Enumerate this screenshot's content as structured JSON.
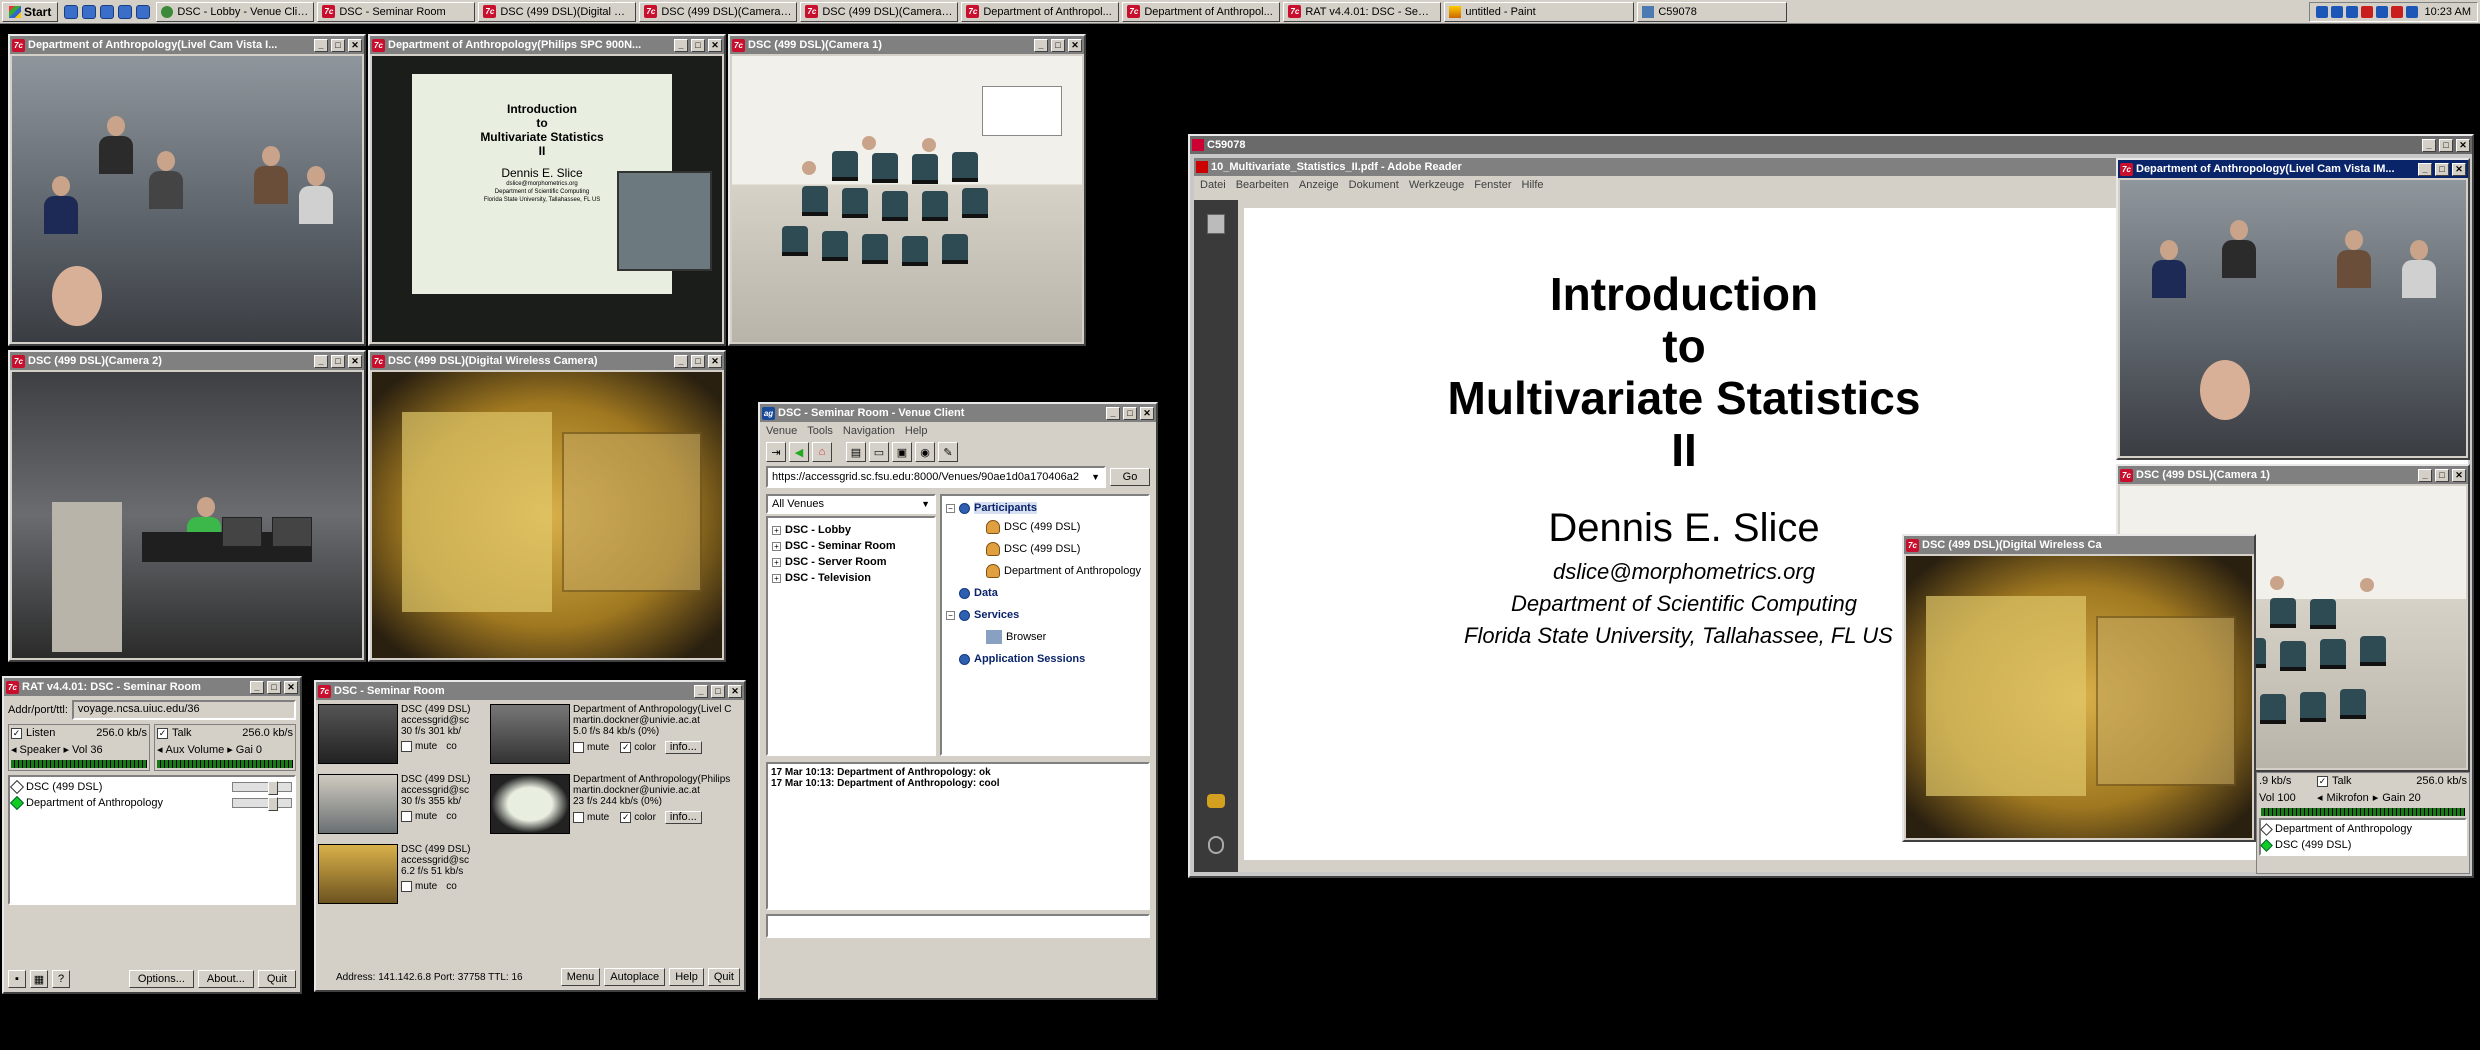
{
  "taskbar": {
    "start_label": "Start",
    "tasks": [
      {
        "label": "DSC - Lobby - Venue Clie...",
        "icon": "globe-icon"
      },
      {
        "label": "DSC - Seminar Room",
        "icon": "vic-icon"
      },
      {
        "label": "DSC (499 DSL)(Digital Wi...",
        "icon": "vic-icon"
      },
      {
        "label": "DSC (499 DSL)(Camera 2)",
        "icon": "vic-icon"
      },
      {
        "label": "DSC (499 DSL)(Camera 1)",
        "icon": "vic-icon"
      },
      {
        "label": "Department of Anthropol...",
        "icon": "vic-icon"
      },
      {
        "label": "Department of Anthropol...",
        "icon": "vic-icon"
      },
      {
        "label": "RAT v4.4.01: DSC - Semi...",
        "icon": "vic-icon"
      },
      {
        "label": "untitled - Paint",
        "icon": "paint-icon"
      },
      {
        "label": "C59078",
        "icon": "vnc-icon"
      }
    ],
    "clock": "10:23 AM"
  },
  "video_windows": {
    "anthro_cam": {
      "title": "Department of Anthropology(Livel Cam Vista I..."
    },
    "anthro_philips": {
      "title": "Department of Anthropology(Philips SPC 900N..."
    },
    "cam1": {
      "title": "DSC (499 DSL)(Camera 1)"
    },
    "cam2": {
      "title": "DSC (499 DSL)(Camera 2)"
    },
    "wireless": {
      "title": "DSC (499 DSL)(Digital Wireless Camera)"
    }
  },
  "slide": {
    "line1": "Introduction",
    "line2": "to",
    "line3": "Multivariate Statistics",
    "line4": "II",
    "author": "Dennis E. Slice",
    "email": "dslice@morphometrics.org",
    "dept": "Department of Scientific Computing",
    "univ": "Florida State University, Tallahassee, FL US"
  },
  "venue_client": {
    "title": "DSC - Seminar Room - Venue Client",
    "menu": [
      "Venue",
      "Tools",
      "Navigation",
      "Help"
    ],
    "url": "https://accessgrid.sc.fsu.edu:8000/Venues/90ae1d0a170406a2",
    "go_label": "Go",
    "venues_select": "All Venues",
    "venues": [
      "DSC - Lobby",
      "DSC - Seminar Room",
      "DSC - Server Room",
      "DSC - Television"
    ],
    "participants_label": "Participants",
    "participants": [
      "DSC (499 DSL)",
      "DSC (499 DSL)",
      "Department of Anthropology"
    ],
    "data_label": "Data",
    "services_label": "Services",
    "browser_label": "Browser",
    "app_sessions_label": "Application Sessions",
    "chat": [
      "17 Mar 10:13: Department of Anthropology: ok",
      "17 Mar 10:13: Department of Anthropology: cool"
    ]
  },
  "rat": {
    "title": "RAT v4.4.01: DSC - Seminar Room",
    "addr_label": "Addr/port/ttl:",
    "addr_value": "voyage.ncsa.uiuc.edu/36",
    "listen_label": "Listen",
    "listen_rate": "256.0 kb/s",
    "talk_label": "Talk",
    "talk_rate": "256.0 kb/s",
    "speaker_label": "Speaker",
    "vol_label": "Vol",
    "vol_value": "36",
    "aux_label": "Aux Volume",
    "gain_label": "Gai",
    "gain_value": "0",
    "participants": [
      "DSC (499 DSL)",
      "Department of Anthropology"
    ],
    "options_label": "Options...",
    "about_label": "About...",
    "quit_label": "Quit"
  },
  "vic": {
    "title": "DSC - Seminar Room",
    "streams": [
      {
        "name": "DSC (499 DSL)",
        "email": "accessgrid@sc",
        "stats": "30 f/s  301 kb/",
        "mute": "mute",
        "color": "co"
      },
      {
        "name": "Department of Anthropology(Livel C",
        "email": "martin.dockner@univie.ac.at",
        "stats": "5.0 f/s    84 kb/s    (0%)",
        "mute": "mute",
        "color": "color",
        "info": "info..."
      },
      {
        "name": "DSC (499 DSL)",
        "email": "accessgrid@sc",
        "stats": "30 f/s  355 kb/",
        "mute": "mute",
        "color": "co"
      },
      {
        "name": "Department of Anthropology(Philips",
        "email": "martin.dockner@univie.ac.at",
        "stats": "23 f/s    244 kb/s    (0%)",
        "mute": "mute",
        "color": "color",
        "info": "info..."
      },
      {
        "name": "DSC (499 DSL)",
        "email": "accessgrid@sc",
        "stats": "6.2 f/s  51 kb/s",
        "mute": "mute",
        "color": "co"
      }
    ],
    "address": "Address: 141.142.6.8   Port: 37758   TTL: 16",
    "menu_label": "Menu",
    "autoplace_label": "Autoplace",
    "help_label": "Help",
    "quit_label": "Quit"
  },
  "vnc": {
    "title": "C59078",
    "reader_title": "10_Multivariate_Statistics_II.pdf - Adobe Reader",
    "reader_menu": [
      "Datei",
      "Bearbeiten",
      "Anzeige",
      "Dokument",
      "Werkzeuge",
      "Fenster",
      "Hilfe"
    ],
    "overlay_anthro": "Department of Anthropology(Livel Cam Vista IM...",
    "overlay_cam1": "DSC (499 DSL)(Camera 1)",
    "overlay_wireless": "DSC (499 DSL)(Digital Wireless Ca",
    "rat_talk_label": "Talk",
    "rat_talk_rate": "256.0 kb/s",
    "rat_listen_rate": ".9 kb/s",
    "rat_vol": "Vol 100",
    "rat_mikrofon": "Mikrofon",
    "rat_gain": "Gain 20",
    "rat_participants": [
      "Department of Anthropology",
      "DSC (499 DSL)"
    ]
  }
}
